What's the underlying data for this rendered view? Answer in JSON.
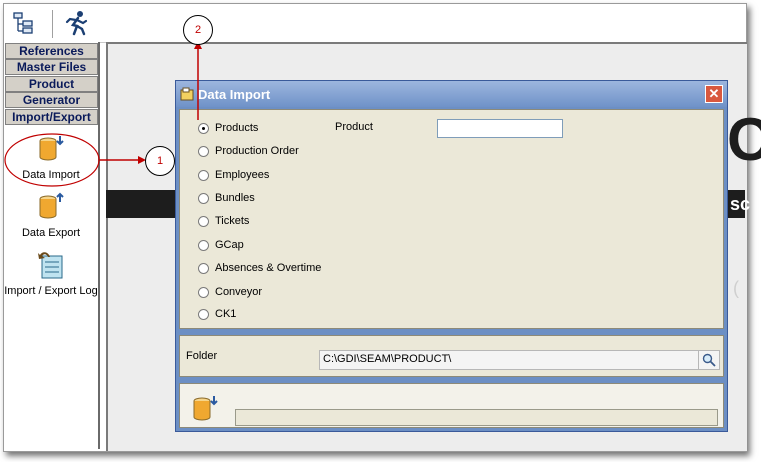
{
  "menu": {
    "references": "References",
    "master_files": "Master Files",
    "product": "Product",
    "generator": "Generator",
    "import_export": "Import/Export"
  },
  "sidebar_items": {
    "data_import": "Data Import",
    "data_export": "Data Export",
    "log": "Import / Export Log"
  },
  "dialog": {
    "title": "Data Import",
    "close_glyph": "✕",
    "options": [
      "Products",
      "Production Order",
      "Employees",
      "Bundles",
      "Tickets",
      "GCap",
      "Absences & Overtime",
      "Conveyor",
      "CK1"
    ],
    "selected": "Products",
    "product_label": "Product",
    "product_value": "",
    "folder_label": "Folder",
    "folder_value": "C:\\GDI\\SEAM\\PRODUCT\\"
  },
  "callouts": {
    "one": "1",
    "two": "2"
  },
  "background_text": {
    "right_top": "O",
    "right_mid": "sc",
    "right_low": "("
  },
  "colors": {
    "accent": "#c00000",
    "dialog_title": "#6f92c8",
    "panel": "#ebe8d8"
  },
  "icons": [
    "tree-view-icon",
    "runner-icon",
    "database-import-icon",
    "database-export-icon",
    "log-icon",
    "search-icon"
  ]
}
